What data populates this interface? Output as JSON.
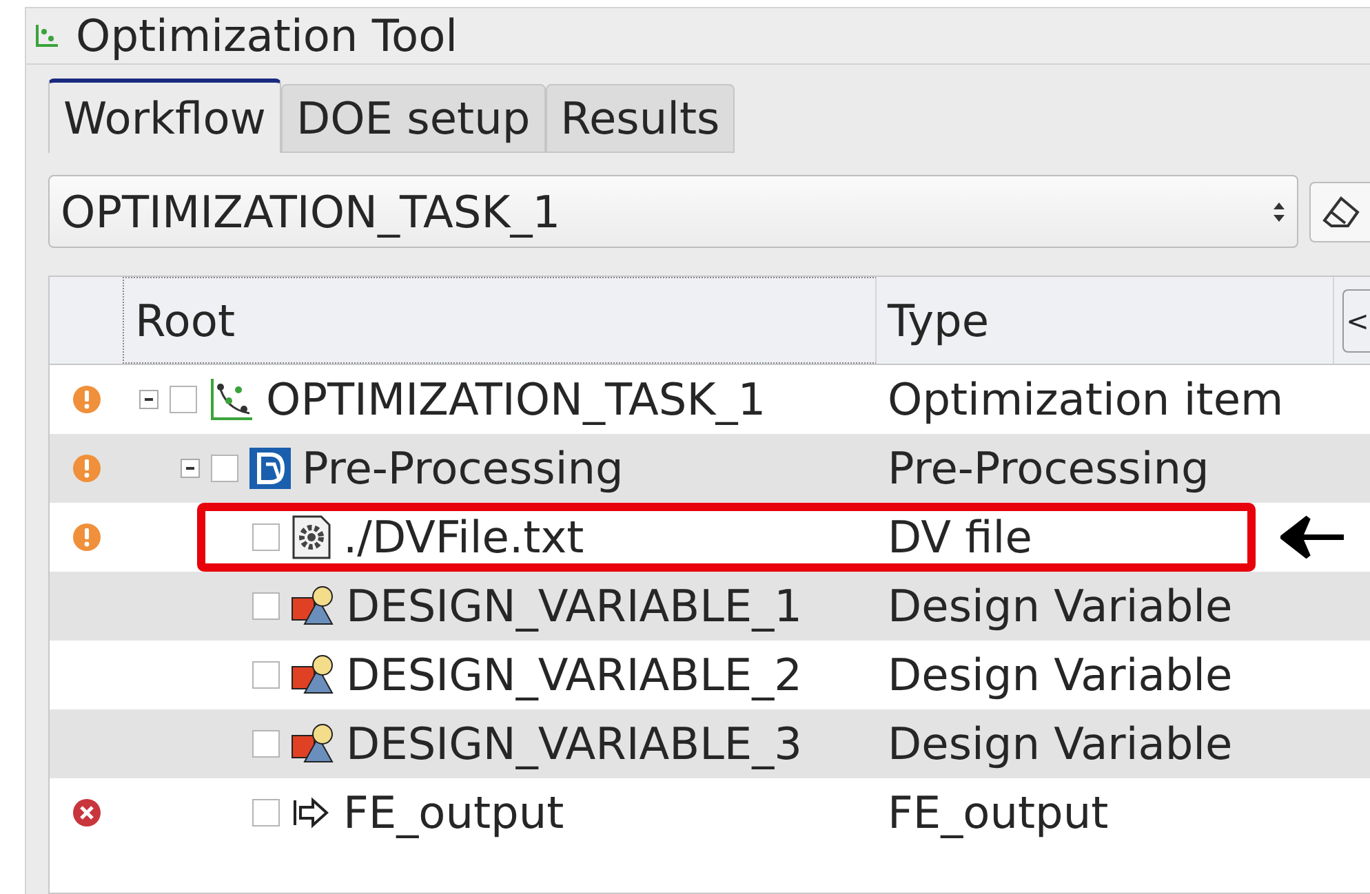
{
  "window": {
    "title": "Optimization Tool"
  },
  "tabs": [
    {
      "label": "Workflow",
      "selected": true
    },
    {
      "label": "DOE setup",
      "selected": false
    },
    {
      "label": "Results",
      "selected": false
    }
  ],
  "task_select": {
    "value": "OPTIMIZATION_TASK_1"
  },
  "tree": {
    "columns": [
      "Root",
      "Type"
    ],
    "scroll_button": "<",
    "items": [
      {
        "warning": true,
        "error": false,
        "kind": "chart",
        "name": "OPTIMIZATION_TASK_1",
        "type": "Optimization item",
        "checked": false,
        "expanded": true,
        "highlighted": false,
        "children": [
          {
            "warning": true,
            "error": false,
            "kind": "badge",
            "name": "Pre-Processing",
            "type": "Pre-Processing",
            "checked": false,
            "expanded": true,
            "highlighted": false,
            "children": [
              {
                "warning": true,
                "error": false,
                "kind": "file",
                "name": "./DVFile.txt",
                "type": "DV file",
                "checked": false,
                "highlighted": true
              },
              {
                "warning": false,
                "error": false,
                "kind": "variable",
                "name": "DESIGN_VARIABLE_1",
                "type": "Design Variable",
                "checked": false,
                "highlighted": false
              },
              {
                "warning": false,
                "error": false,
                "kind": "variable",
                "name": "DESIGN_VARIABLE_2",
                "type": "Design Variable",
                "checked": false,
                "highlighted": false
              },
              {
                "warning": false,
                "error": false,
                "kind": "variable",
                "name": "DESIGN_VARIABLE_3",
                "type": "Design Variable",
                "checked": false,
                "highlighted": false
              },
              {
                "warning": false,
                "error": true,
                "kind": "output",
                "name": "FE_output",
                "type": "FE_output",
                "checked": false,
                "highlighted": false
              }
            ]
          }
        ]
      }
    ]
  }
}
